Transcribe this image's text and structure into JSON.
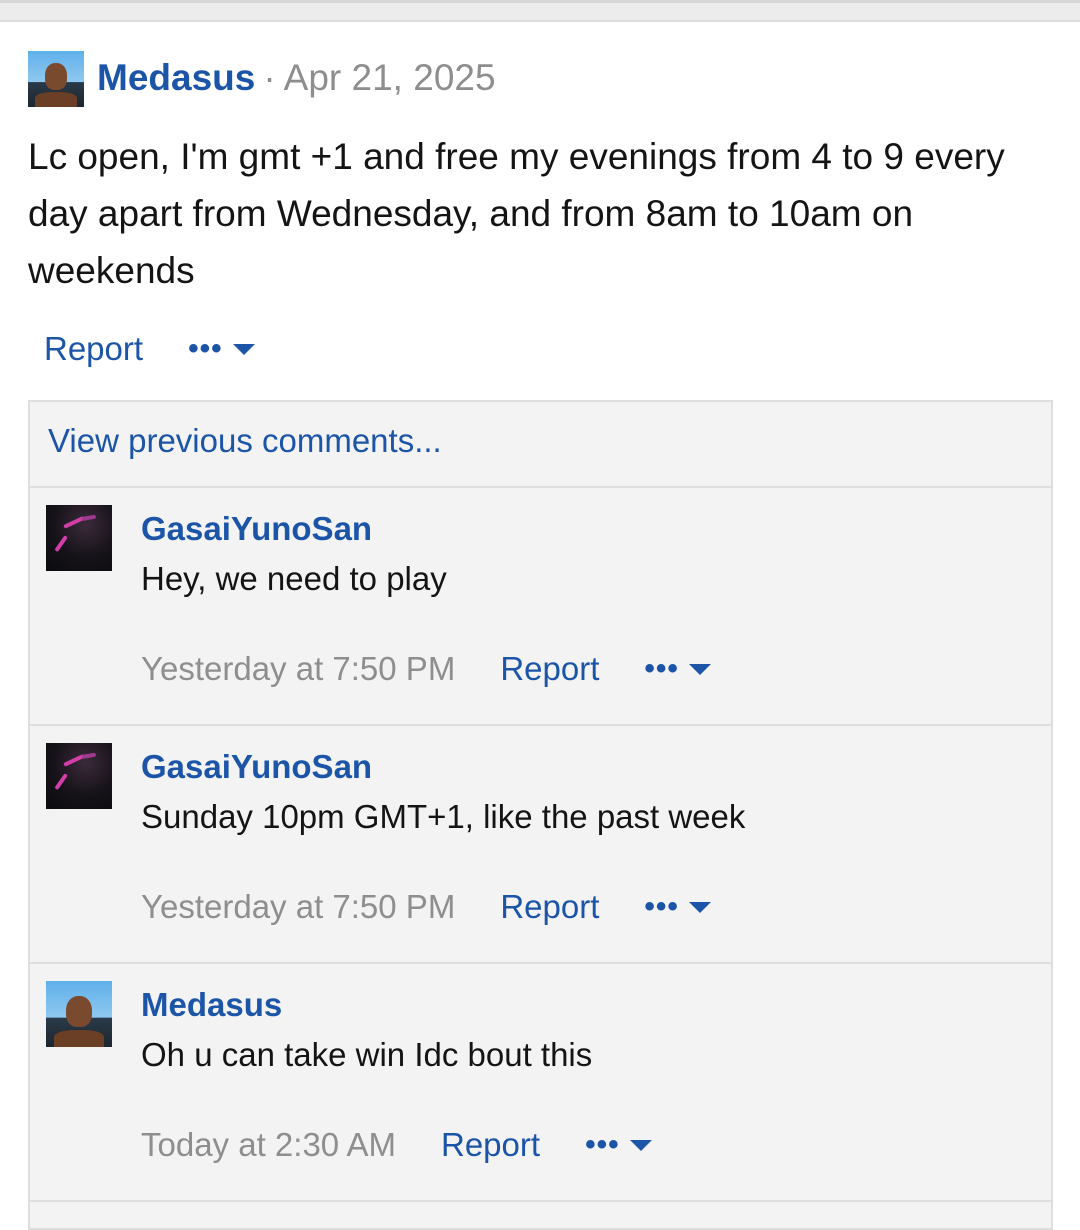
{
  "post": {
    "author": "Medasus",
    "separator": "·",
    "date": "Apr 21, 2025",
    "body": "Lc open, I'm gmt +1 and free my evenings from 4 to 9 every day apart from Wednesday, and from 8am to 10am on weekends",
    "report_label": "Report",
    "more_label": "•••"
  },
  "comments": {
    "view_previous": "View previous comments...",
    "items": [
      {
        "author": "GasaiYunoSan",
        "text": "Hey, we need to play",
        "time": "Yesterday at 7:50 PM",
        "report_label": "Report",
        "more_label": "•••"
      },
      {
        "author": "GasaiYunoSan",
        "text": "Sunday 10pm GMT+1, like the past week",
        "time": "Yesterday at 7:50 PM",
        "report_label": "Report",
        "more_label": "•••"
      },
      {
        "author": "Medasus",
        "text": "Oh u can take win Idc bout this",
        "time": "Today at 2:30 AM",
        "report_label": "Report",
        "more_label": "•••"
      }
    ]
  },
  "colors": {
    "link": "#1c55a8",
    "muted": "#8e8e8e",
    "text": "#141414",
    "comments_bg": "#f3f3f3"
  }
}
